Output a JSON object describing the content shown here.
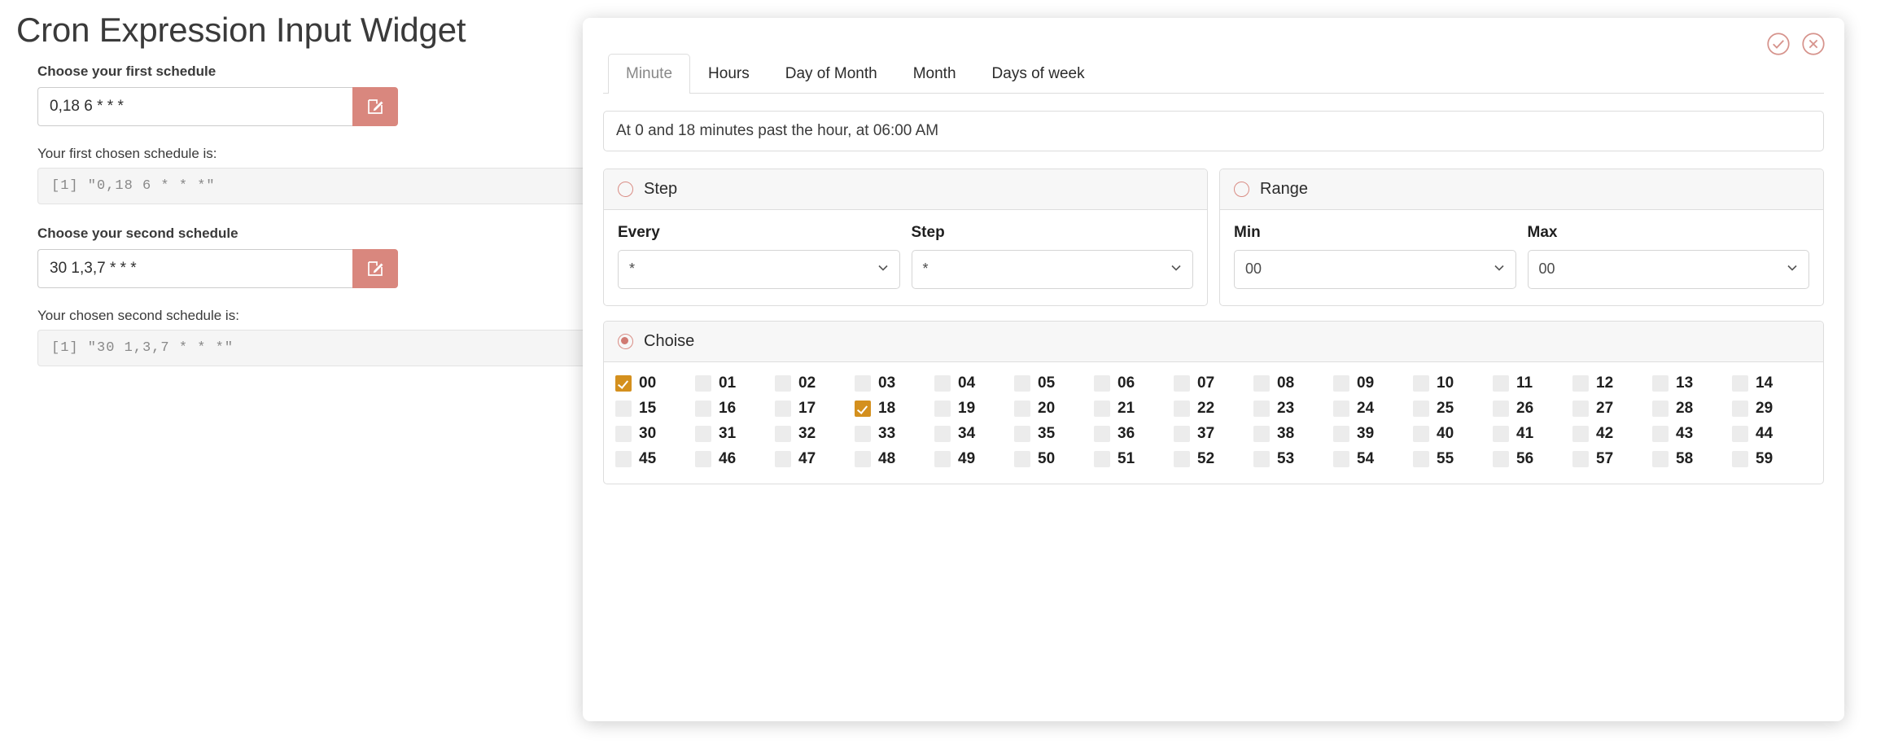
{
  "page": {
    "title": "Cron Expression Input Widget",
    "first": {
      "label": "Choose your first schedule",
      "input_value": "0,18 6 * * *",
      "input_placeholder": "* * * * *",
      "result_label": "Your first chosen schedule is:",
      "result_code": "[1] \"0,18 6 * * *\""
    },
    "second": {
      "label": "Choose your second schedule",
      "input_value": "30 1,3,7 * * *",
      "input_placeholder": "* * * * *",
      "result_label": "Your chosen second schedule is:",
      "result_code": "[1] \"30 1,3,7 * * *\""
    },
    "edit_icon": "edit-pencil-square-icon"
  },
  "modal": {
    "confirm_icon": "check-circle-icon",
    "close_icon": "close-circle-icon",
    "tabs": [
      {
        "label": "Minute",
        "active": true
      },
      {
        "label": "Hours",
        "active": false
      },
      {
        "label": "Day of Month",
        "active": false
      },
      {
        "label": "Month",
        "active": false
      },
      {
        "label": "Days of week",
        "active": false
      }
    ],
    "description": "At 0 and 18 minutes past the hour, at 06:00 AM",
    "step_panel": {
      "title": "Step",
      "selected": false,
      "every_label": "Every",
      "every_value": "*",
      "step_label": "Step",
      "step_value": "*"
    },
    "range_panel": {
      "title": "Range",
      "selected": false,
      "min_label": "Min",
      "min_value": "00",
      "max_label": "Max",
      "max_value": "00"
    },
    "choise_panel": {
      "title": "Choise",
      "selected": true,
      "rows": [
        [
          "00",
          "01",
          "02",
          "03",
          "04",
          "05",
          "06",
          "07",
          "08",
          "09",
          "10",
          "11",
          "12",
          "13",
          "14"
        ],
        [
          "15",
          "16",
          "17",
          "18",
          "19",
          "20",
          "21",
          "22",
          "23",
          "24",
          "25",
          "26",
          "27",
          "28",
          "29"
        ],
        [
          "30",
          "31",
          "32",
          "33",
          "34",
          "35",
          "36",
          "37",
          "38",
          "39",
          "40",
          "41",
          "42",
          "43",
          "44"
        ],
        [
          "45",
          "46",
          "47",
          "48",
          "49",
          "50",
          "51",
          "52",
          "53",
          "54",
          "55",
          "56",
          "57",
          "58",
          "59"
        ]
      ],
      "checked": [
        "00",
        "18"
      ]
    }
  },
  "colors": {
    "accent_red": "#d9877e",
    "checkbox_checked": "#d4901e",
    "radio_outline": "#d98c84",
    "code_bg": "#f5f5f5"
  }
}
